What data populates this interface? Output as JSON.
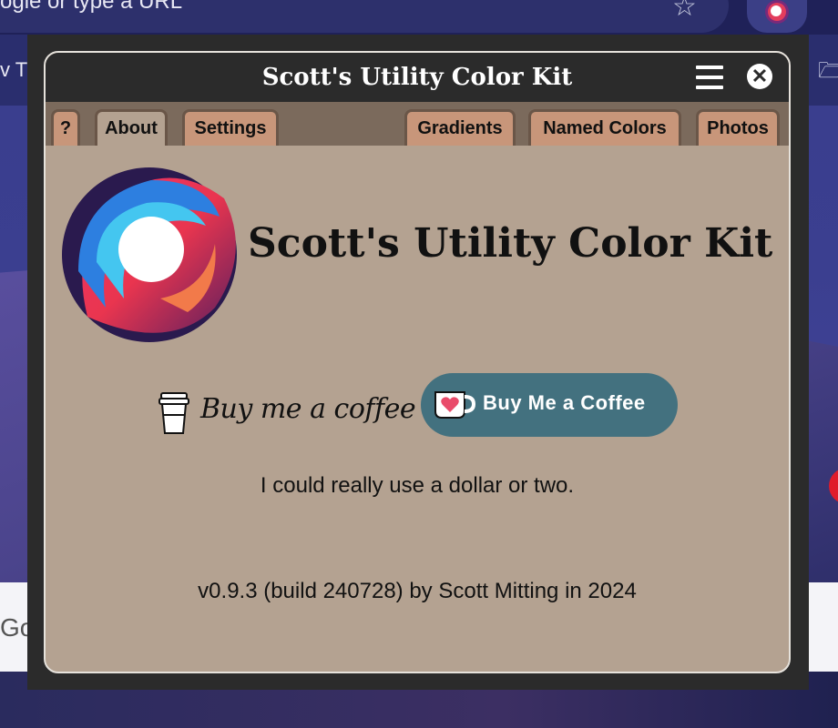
{
  "browser": {
    "omnibox_text": "ogle or type a URL",
    "bookmark_text": "v T",
    "page_text": "Go"
  },
  "popup": {
    "title": "Scott's Utility Color Kit",
    "tabs": [
      {
        "label": "?",
        "active": false
      },
      {
        "label": "About",
        "active": true
      },
      {
        "label": "Settings",
        "active": false
      },
      {
        "label": "Gradients",
        "active": false
      },
      {
        "label": "Named Colors",
        "active": false
      },
      {
        "label": "Photos",
        "active": false
      }
    ],
    "heading": "Scott's Utility Color Kit",
    "coffee_link_label": "Buy me a coffee",
    "kofi_label": "Buy Me a Coffee",
    "note": "I could really use a dollar or two.",
    "version": "v0.9.3 (build 240728) by Scott Mitting in 2024"
  },
  "colors": {
    "popup_bg": "#b4a291",
    "titlebar": "#2b2b2b",
    "tab": "#c8967a",
    "kofi": "#43717f"
  }
}
